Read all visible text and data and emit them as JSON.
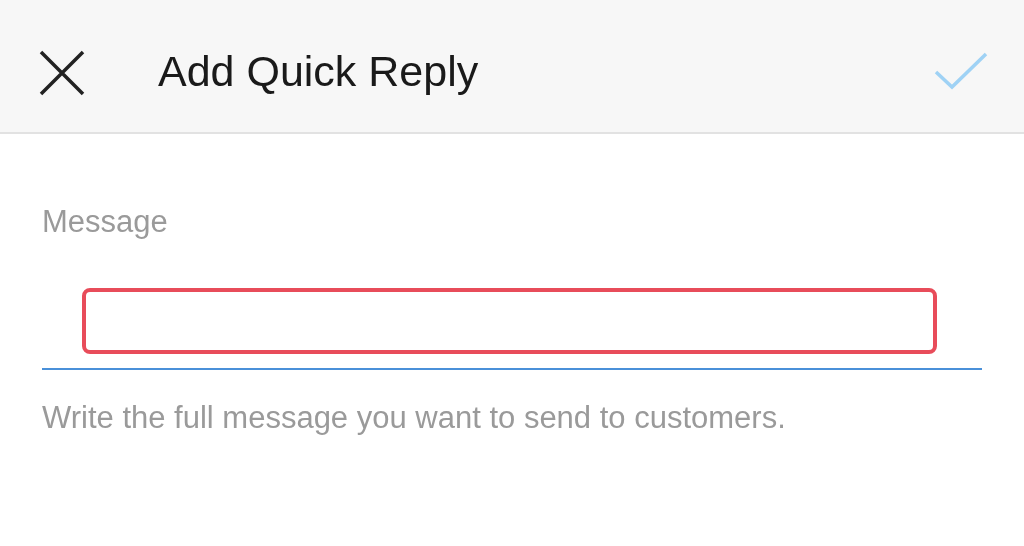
{
  "header": {
    "title": "Add Quick Reply",
    "done_enabled": false
  },
  "message": {
    "label": "Message",
    "highlighted": true,
    "helper": "Write the full message you want to send to customers."
  }
}
